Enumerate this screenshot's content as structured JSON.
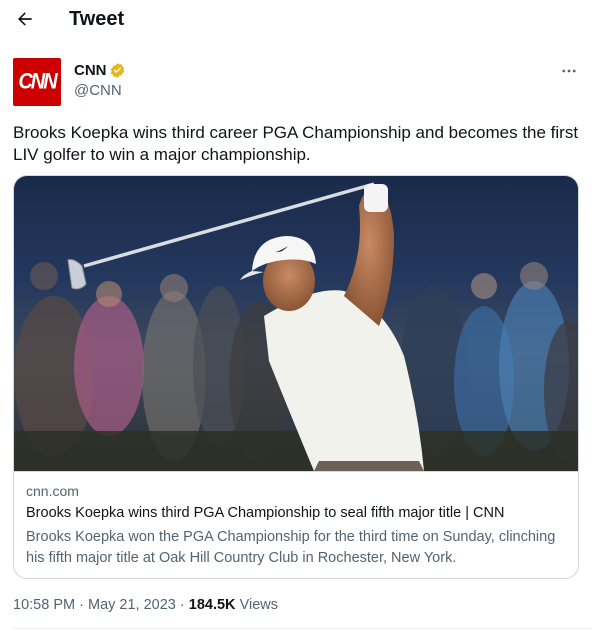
{
  "header": {
    "title": "Tweet"
  },
  "author": {
    "avatar_text": "CNN",
    "name": "CNN",
    "handle": "@CNN"
  },
  "tweet": {
    "text": "Brooks Koepka wins third career PGA Championship and becomes the first LIV golfer to win a major championship."
  },
  "card": {
    "domain": "cnn.com",
    "title": "Brooks Koepka wins third PGA Championship to seal fifth major title | CNN",
    "description": "Brooks Koepka won the PGA Championship for the third time on Sunday, clinching his fifth major title at Oak Hill Country Club in Rochester, New York."
  },
  "meta": {
    "time": "10:58 PM",
    "separator": "·",
    "date": "May 21, 2023",
    "views_count": "184.5K",
    "views_label": "Views"
  },
  "colors": {
    "text": "#0f1419",
    "secondary": "#536471",
    "border": "#cfd9de",
    "cnn_red": "#cc0000",
    "verified_gold": "#e2b719"
  },
  "icons": {
    "back": "arrow-left-icon",
    "verified": "verified-badge-icon",
    "more": "more-horizontal-icon"
  }
}
